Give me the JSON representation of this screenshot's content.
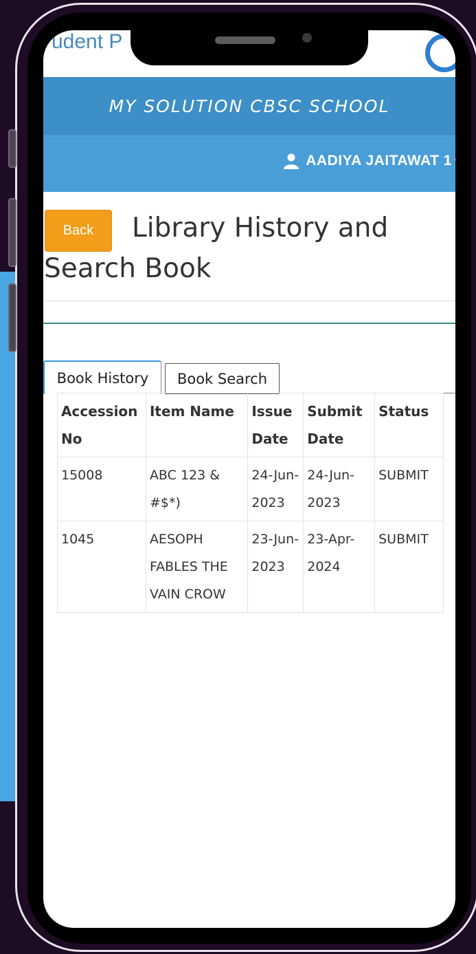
{
  "app": {
    "title": "udent P"
  },
  "header": {
    "school_name": "MY SOLUTION CBSC SCHOOL"
  },
  "user": {
    "name": "AADIYA JAITAWAT 1"
  },
  "page": {
    "back_label": "Back",
    "title": "Library History and Search Book"
  },
  "tabs": [
    {
      "label": "Book History",
      "active": true
    },
    {
      "label": "Book Search",
      "active": false
    }
  ],
  "table": {
    "headers": [
      "Accession No",
      "Item Name",
      "Issue Date",
      "Submit Date",
      "Status"
    ],
    "rows": [
      {
        "accession": "15008",
        "item": "ABC 123 & #$*)",
        "issue": "24-Jun-2023",
        "submit": "24-Jun-2023",
        "status": "SUBMIT"
      },
      {
        "accession": "1045",
        "item": "AESOPH FABLES THE VAIN CROW",
        "issue": "23-Jun-2023",
        "submit": "23-Apr-2024",
        "status": "SUBMIT"
      }
    ]
  },
  "colors": {
    "header_bg": "#3d8fc7",
    "user_bar_bg": "#4a9ed8",
    "back_button": "#f39d1b",
    "outer_bg": "#1e0b24"
  },
  "icons": {
    "user": "user-icon",
    "caret": "caret-down-icon",
    "browser": "browser-icon"
  }
}
